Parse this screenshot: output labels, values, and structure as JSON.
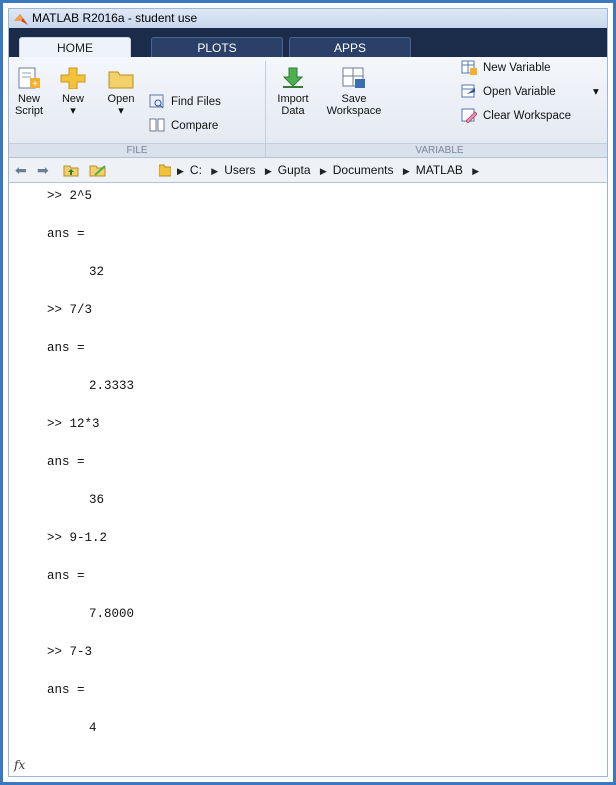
{
  "window": {
    "title": "MATLAB R2016a - student use"
  },
  "tabs": [
    {
      "label": "HOME",
      "active": true
    },
    {
      "label": "PLOTS",
      "active": false
    },
    {
      "label": "APPS",
      "active": false
    }
  ],
  "ribbon": {
    "file_group_label": "FILE",
    "variable_group_label": "VARIABLE",
    "new_script": [
      "New",
      "Script"
    ],
    "new": "New",
    "open": "Open",
    "find_files": "Find Files",
    "compare": "Compare",
    "import_data": [
      "Import",
      "Data"
    ],
    "save_workspace": [
      "Save",
      "Workspace"
    ],
    "new_variable": "New Variable",
    "open_variable": "Open Variable",
    "clear_workspace": "Clear Workspace"
  },
  "path": {
    "crumbs": [
      "C:",
      "Users",
      "Gupta",
      "Documents",
      "MATLAB"
    ]
  },
  "console": {
    "lines": [
      ">> 2^5",
      "ans =",
      "32",
      ">> 7/3",
      "ans =",
      "2.3333",
      ">> 12*3",
      "ans =",
      "36",
      ">> 9-1.2",
      "ans =",
      "7.8000",
      ">> 7-3",
      "ans =",
      "4"
    ]
  },
  "colors": {
    "border": "#3a78c0",
    "tabbar": "#1a2c4a"
  },
  "icons": {
    "logo": "matlab-logo-icon",
    "fx": "fx-icon"
  }
}
